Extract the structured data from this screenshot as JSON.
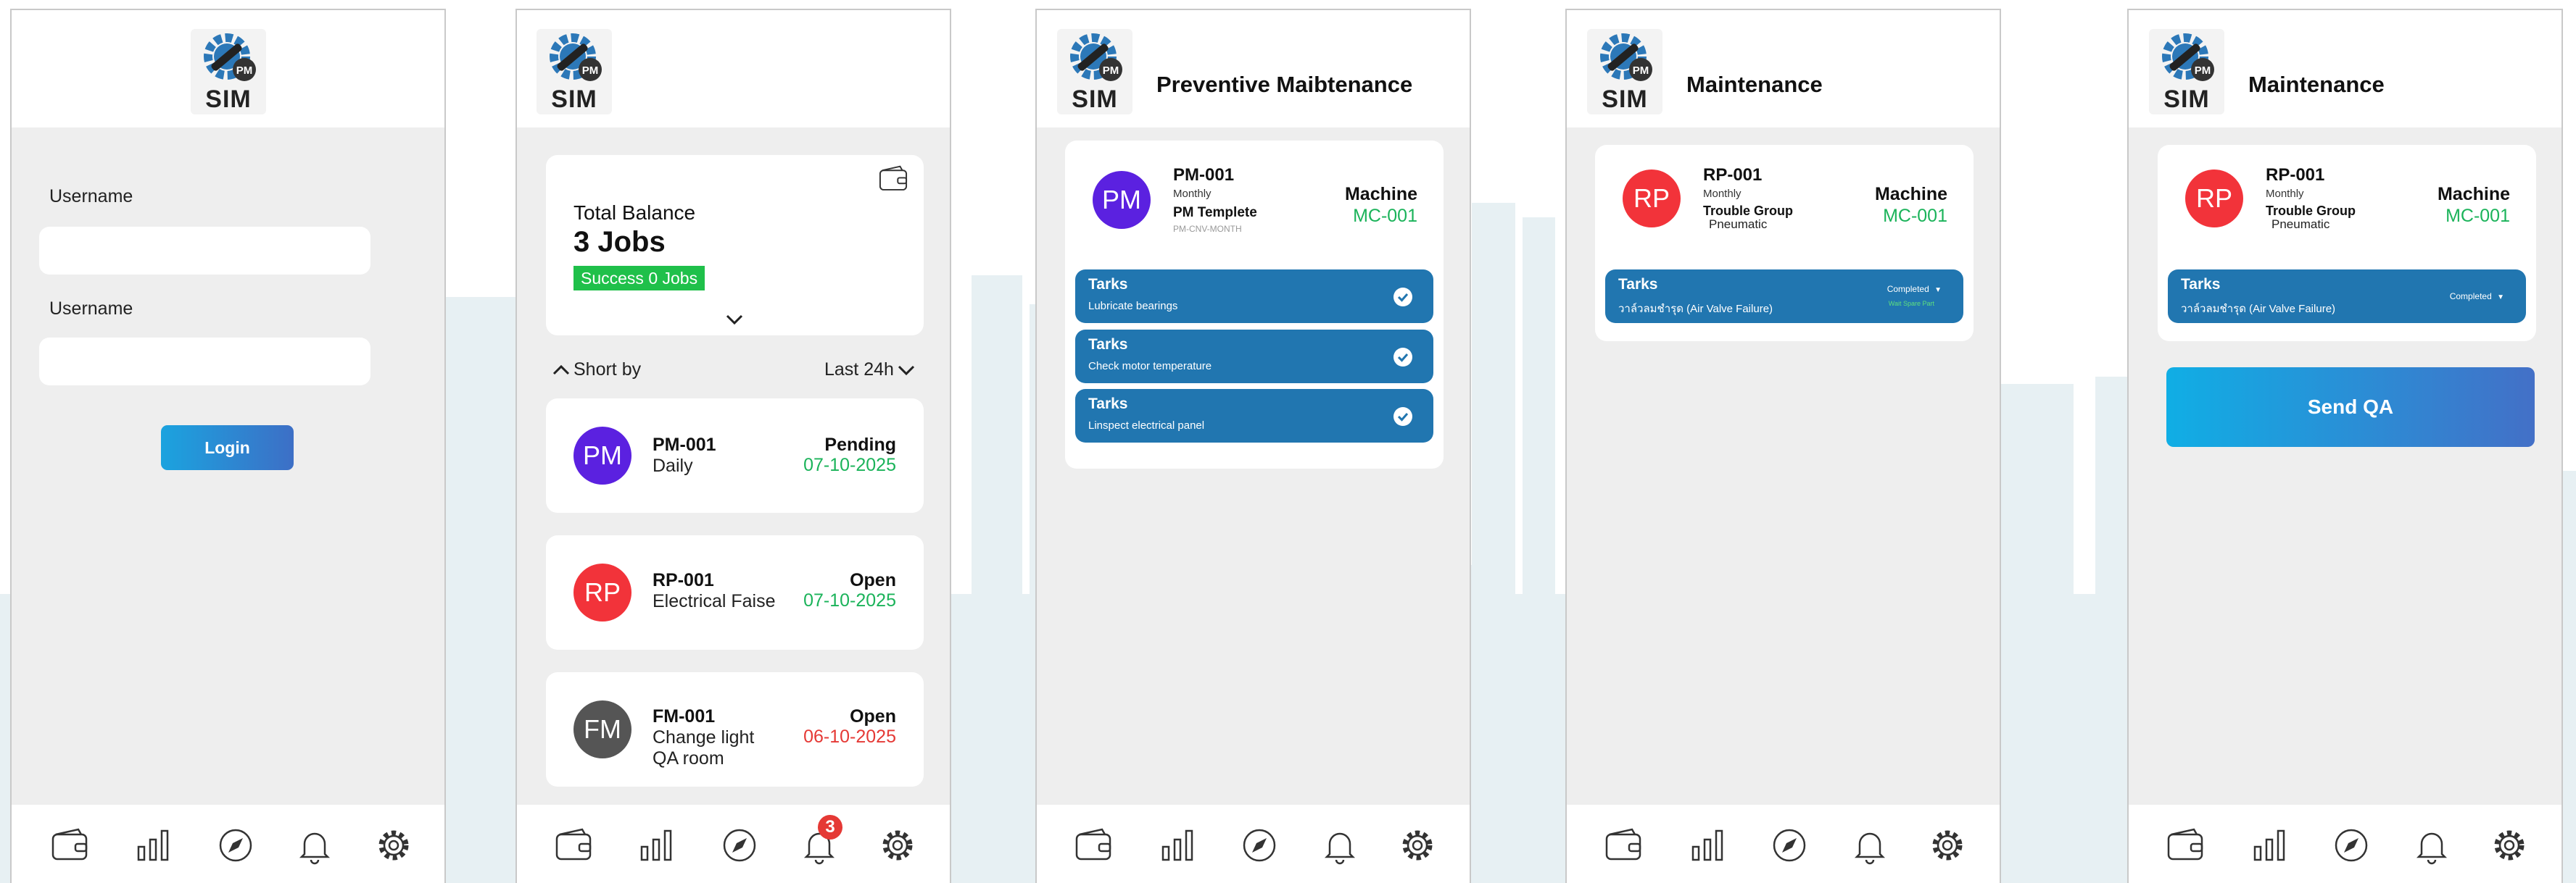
{
  "brand": {
    "logo_text": "SIM",
    "logo_badge": "PM",
    "blue": "#1f6ea7",
    "green": "#1bb35a",
    "red": "#e53935"
  },
  "login": {
    "username_label_1": "Username",
    "username_label_2": "Username",
    "username_value_1": "",
    "username_value_2": "",
    "login_button": "Login"
  },
  "dashboard": {
    "balance_title": "Total Balance",
    "balance_value": "3 Jobs",
    "success_badge": "Success 0 Jobs",
    "sort_label": "Short by",
    "range_label": "Last 24h",
    "notification_count": "3",
    "jobs": [
      {
        "avatar": "PM",
        "avatar_color": "#5b21e0",
        "id": "PM-001",
        "line1": "Daily",
        "line2": "",
        "status": "Pending",
        "date": "07-10-2025",
        "date_color": "green"
      },
      {
        "avatar": "RP",
        "avatar_color": "#f2333a",
        "id": "RP-001",
        "line1": "Electrical Faise",
        "line2": "",
        "status": "Open",
        "date": "07-10-2025",
        "date_color": "green"
      },
      {
        "avatar": "FM",
        "avatar_color": "#555555",
        "id": "FM-001",
        "line1": "Change light",
        "line2": "QA room",
        "status": "Open",
        "date": "06-10-2025",
        "date_color": "red"
      }
    ]
  },
  "pm_detail": {
    "title": "Preventive Maibtenance",
    "avatar": "PM",
    "id": "PM-001",
    "frequency": "Monthly",
    "template": "PM Templete",
    "template_code": "PM-CNV-MONTH",
    "machine_label": "Machine",
    "machine_value": "MC-001",
    "tasks": [
      {
        "title": "Tarks",
        "desc": "Lubricate bearings"
      },
      {
        "title": "Tarks",
        "desc": "Check motor temperature"
      },
      {
        "title": "Tarks",
        "desc": "Linspect electrical panel"
      }
    ]
  },
  "rp_detail": {
    "title": "Maintenance",
    "avatar": "RP",
    "id": "RP-001",
    "frequency": "Monthly",
    "group": "Trouble Group",
    "group_value": "Pneumatic",
    "machine_label": "Machine",
    "machine_value": "MC-001",
    "task_title": "Tarks",
    "task_desc": "วาล์วลมชำรุด (Air Valve Failure)",
    "task_status": "Completed",
    "task_note": "Wait Spare Part"
  },
  "rp_send": {
    "title": "Maintenance",
    "avatar": "RP",
    "id": "RP-001",
    "frequency": "Monthly",
    "group": "Trouble Group",
    "group_value": "Pneumatic",
    "machine_label": "Machine",
    "machine_value": "MC-001",
    "task_title": "Tarks",
    "task_desc": "วาล์วลมชำรุด (Air Valve Failure)",
    "task_status": "Completed",
    "send_button": "Send QA"
  },
  "nav_icons": [
    "wallet-icon",
    "bar-chart-icon",
    "compass-icon",
    "bell-icon",
    "gear-icon"
  ]
}
